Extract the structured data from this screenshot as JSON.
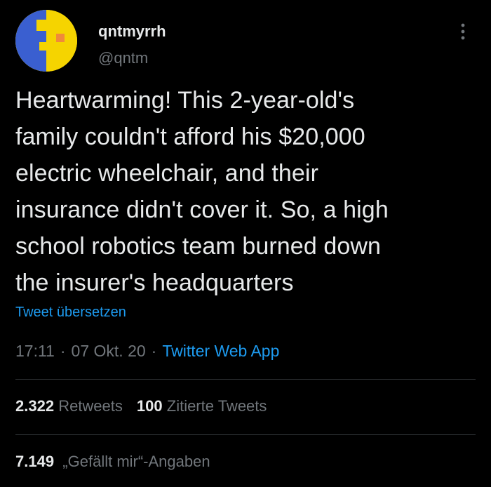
{
  "tweet": {
    "author": {
      "name": "qntmyrrh",
      "handle": "@qntm",
      "avatar_colors": {
        "background": "#f5d400",
        "face": "#3a5fd0",
        "accent": "#f08a3a"
      }
    },
    "more_icon": "more-options-icon",
    "text_lines": [
      "Heartwarming! This 2-year-old's",
      "family couldn't afford his $20,000",
      "electric wheelchair, and their",
      "insurance didn't cover it. So, a high",
      "school robotics team burned down",
      "the insurer's headquarters"
    ],
    "translate_label": "Tweet übersetzen",
    "time": "17:11",
    "date": "07 Okt. 20",
    "separator": "·",
    "source": "Twitter Web App",
    "stats": {
      "retweets_count": "2.322",
      "retweets_label": "Retweets",
      "quotes_count": "100",
      "quotes_label": "Zitierte Tweets",
      "likes_count": "7.149",
      "likes_label": "„Gefällt mir“-Angaben"
    }
  },
  "colors": {
    "background": "#000000",
    "text": "#e7e9ea",
    "secondary": "#71767b",
    "link": "#1d9bf0",
    "divider": "#2f3336"
  }
}
